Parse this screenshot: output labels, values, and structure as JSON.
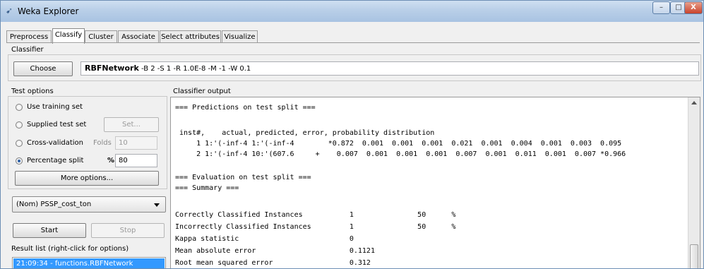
{
  "window": {
    "title": "Weka Explorer",
    "app_icon": "weka-bird-icon",
    "minimize_glyph": "–",
    "maximize_glyph": "□",
    "close_glyph": "X"
  },
  "tabs": [
    {
      "label": "Preprocess"
    },
    {
      "label": "Classify",
      "active": true
    },
    {
      "label": "Cluster"
    },
    {
      "label": "Associate"
    },
    {
      "label": "Select attributes"
    },
    {
      "label": "Visualize"
    }
  ],
  "classifier": {
    "section_label": "Classifier",
    "choose_label": "Choose",
    "name": "RBFNetwork",
    "options": " -B 2 -S 1 -R 1.0E-8 -M -1 -W 0.1"
  },
  "test_options": {
    "section_label": "Test options",
    "use_training": "Use training set",
    "supplied": "Supplied test set",
    "set_button": "Set...",
    "cross_validation": "Cross-validation",
    "folds_label": "Folds",
    "folds_value": "10",
    "percentage_split": "Percentage split",
    "percent_label": "%",
    "percent_value": "80",
    "selected": "Percentage split",
    "more_options": "More options..."
  },
  "class_attribute": "(Nom) PSSP_cost_ton",
  "start_label": "Start",
  "stop_label": "Stop",
  "result_list": {
    "label": "Result list (right-click for options)",
    "items": [
      "21:09:34 - functions.RBFNetwork"
    ]
  },
  "output": {
    "label": "Classifier output",
    "lines": [
      "=== Predictions on test split ===",
      "",
      " inst#,    actual, predicted, error, probability distribution",
      "     1 1:'(-inf-4 1:'(-inf-4        *0.872  0.001  0.001  0.001  0.021  0.001  0.004  0.001  0.003  0.095",
      "     2 1:'(-inf-4 10:'(607.6     +    0.007  0.001  0.001  0.001  0.007  0.001  0.011  0.001  0.007 *0.966",
      "",
      "=== Evaluation on test split ===",
      "=== Summary ===",
      "",
      "Correctly Classified Instances           1               50      %",
      "Incorrectly Classified Instances         1               50      %",
      "Kappa statistic                          0",
      "Mean absolute error                      0.1121",
      "Root mean squared error                  0.312"
    ]
  }
}
